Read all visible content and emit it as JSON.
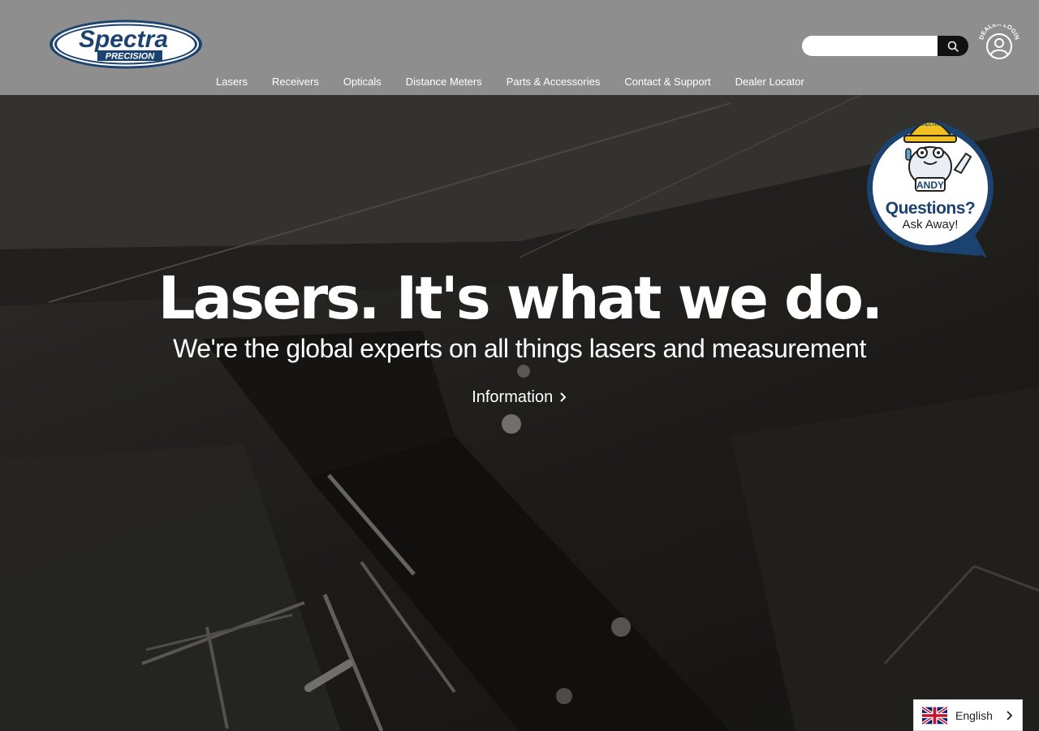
{
  "header": {
    "logo": {
      "brand": "Spectra",
      "sub": "PRECISION"
    },
    "search": {
      "placeholder": "",
      "icon": "search-icon"
    },
    "dealer_login": {
      "label": "DEALER LOGIN",
      "icon": "user-icon"
    }
  },
  "nav": {
    "items": [
      {
        "label": "Lasers"
      },
      {
        "label": "Receivers"
      },
      {
        "label": "Opticals"
      },
      {
        "label": "Distance Meters"
      },
      {
        "label": "Parts & Accessories"
      },
      {
        "label": "Contact & Support"
      },
      {
        "label": "Dealer Locator"
      }
    ]
  },
  "hero": {
    "headline": "Lasers. It's what we do.",
    "subhead": "We're the global experts on all things lasers and measurement",
    "link_label": "Information",
    "link_icon": "chevron-right-icon"
  },
  "chat": {
    "mascot_badge": "ANDY",
    "hat_text": "SPECTRA",
    "title": "Questions?",
    "subtitle": "Ask Away!"
  },
  "language": {
    "selected": "English",
    "flag": "uk-flag-icon"
  },
  "colors": {
    "header_bg": "#8e8e8e",
    "brand_blue": "#1c4370",
    "accent_yellow": "#f2c020"
  }
}
